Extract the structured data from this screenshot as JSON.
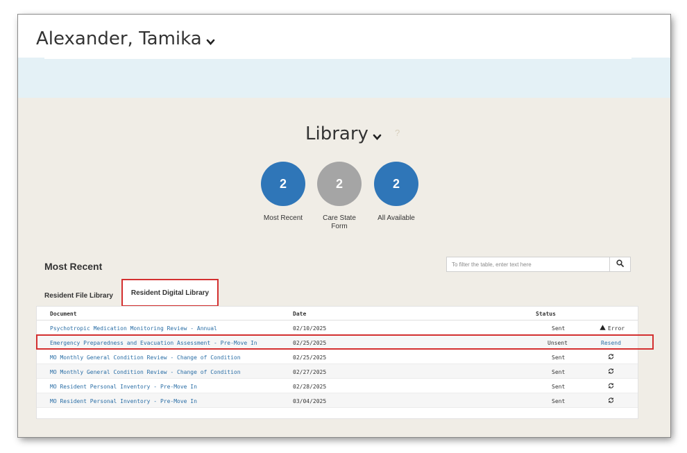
{
  "header": {
    "patient_name": "Alexander, Tamika"
  },
  "library": {
    "title": "Library",
    "help": "?",
    "counters": [
      {
        "count": "2",
        "label": "Most Recent",
        "color": "#2f76b8"
      },
      {
        "count": "2",
        "label": "Care State Form",
        "color": "#a5a5a5"
      },
      {
        "count": "2",
        "label": "All Available",
        "color": "#2f76b8"
      }
    ]
  },
  "section": {
    "title": "Most Recent",
    "filter_placeholder": "To filter the table, enter text here"
  },
  "tabs": [
    {
      "label": "Resident File Library"
    },
    {
      "label": "Resident Digital Library",
      "active": true
    }
  ],
  "table": {
    "headers": {
      "document": "Document",
      "date": "Date",
      "status": "Status"
    },
    "rows": [
      {
        "document": "Psychotropic Medication Monitoring Review - Annual",
        "date": "02/10/2025",
        "status": "Sent",
        "action": "Error",
        "action_icon": "warning-icon"
      },
      {
        "document": "Emergency Preparedness and Evacuation Assessment - Pre-Move In",
        "date": "02/25/2025",
        "status": "Unsent",
        "action": "Resend",
        "action_icon": ""
      },
      {
        "document": "MO Monthly General Condition Review - Change of Condition",
        "date": "02/25/2025",
        "status": "Sent",
        "action": "",
        "action_icon": "refresh-icon"
      },
      {
        "document": "MO Monthly General Condition Review - Change of Condition",
        "date": "02/27/2025",
        "status": "Sent",
        "action": "",
        "action_icon": "refresh-icon"
      },
      {
        "document": "MO Resident Personal Inventory - Pre-Move In",
        "date": "02/28/2025",
        "status": "Sent",
        "action": "",
        "action_icon": "refresh-icon"
      },
      {
        "document": "MO Resident Personal Inventory - Pre-Move In",
        "date": "03/04/2025",
        "status": "Sent",
        "action": "",
        "action_icon": "refresh-icon"
      }
    ]
  },
  "colors": {
    "accent_blue": "#2f76b8",
    "highlight_red": "#d32f2f",
    "link": "#2a6ea6"
  }
}
